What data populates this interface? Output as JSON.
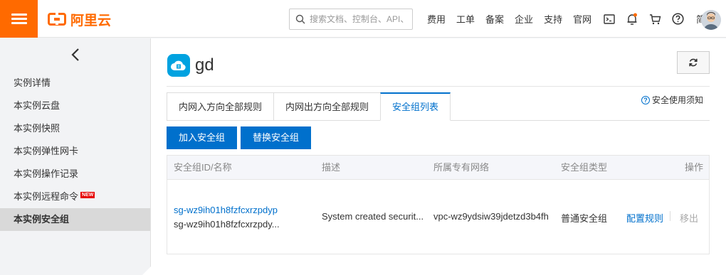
{
  "header": {
    "brand": "阿里云",
    "search_placeholder": "搜索文档、控制台、API、",
    "nav": [
      "费用",
      "工单",
      "备案",
      "企业",
      "支持",
      "官网"
    ],
    "icons": [
      "terminal-icon",
      "bell-icon",
      "cart-icon",
      "help-icon"
    ],
    "language": "简体",
    "accent_color": "#ff6a00"
  },
  "sidebar": {
    "items": [
      {
        "label": "实例详情"
      },
      {
        "label": "本实例云盘"
      },
      {
        "label": "本实例快照"
      },
      {
        "label": "本实例弹性网卡"
      },
      {
        "label": "本实例操作记录"
      },
      {
        "label": "本实例远程命令",
        "badge": "NEW"
      },
      {
        "label": "本实例安全组",
        "active": true
      }
    ]
  },
  "main": {
    "title": "gd",
    "tabs": [
      {
        "label": "内网入方向全部规则"
      },
      {
        "label": "内网出方向全部规则"
      },
      {
        "label": "安全组列表",
        "active": true
      }
    ],
    "notice": "安全使用须知",
    "buttons": {
      "add": "加入安全组",
      "replace": "替换安全组"
    },
    "table": {
      "headers": [
        "安全组ID/名称",
        "描述",
        "所属专有网络",
        "安全组类型",
        "操作"
      ],
      "rows": [
        {
          "id": "sg-wz9ih01h8fzfcxrzpdyp",
          "name": "sg-wz9ih01h8fzfcxrzpdy...",
          "description": "System created securit...",
          "vpc": "vpc-wz9ydsiw39jdetzd3b4fh",
          "type": "普通安全组",
          "action_configure": "配置规则",
          "action_remove": "移出"
        }
      ]
    },
    "link_color": "#0070cc"
  }
}
